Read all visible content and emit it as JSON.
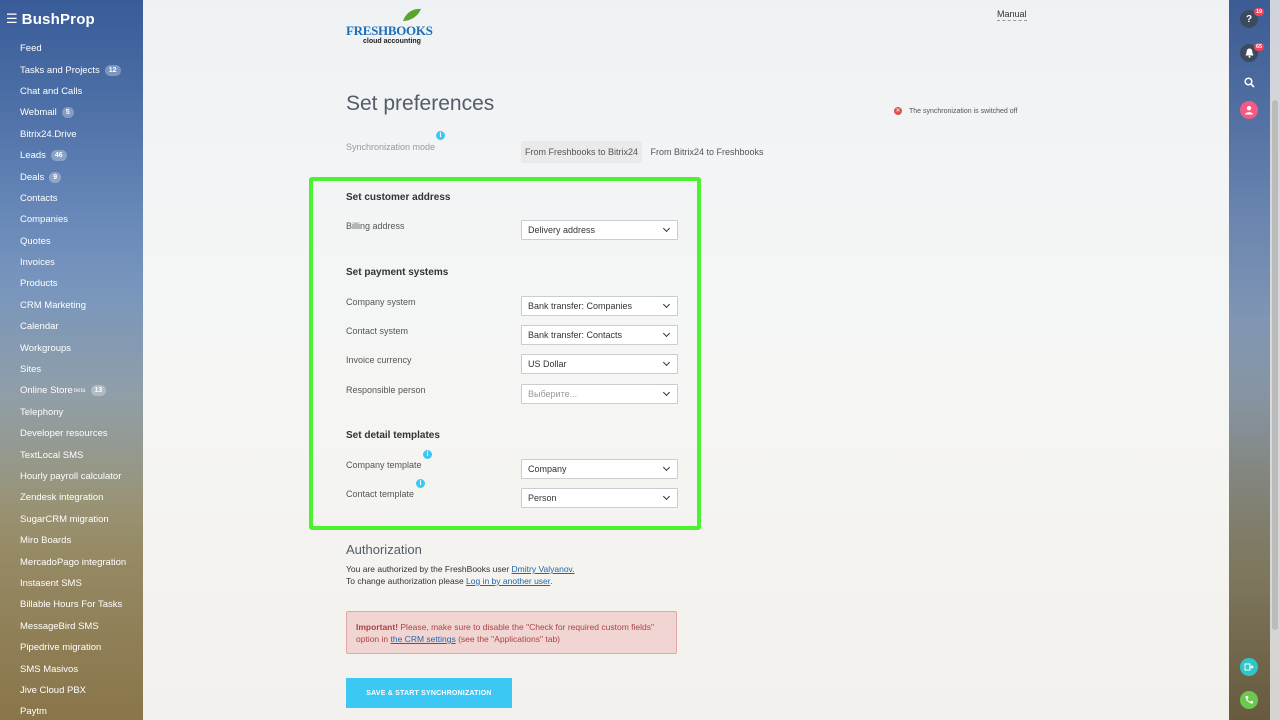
{
  "sidebar": {
    "brand": "BushProp",
    "items": [
      {
        "label": "Feed",
        "badge": ""
      },
      {
        "label": "Tasks and Projects",
        "badge": "12"
      },
      {
        "label": "Chat and Calls",
        "badge": ""
      },
      {
        "label": "Webmail",
        "badge": "5"
      },
      {
        "label": "Bitrix24.Drive",
        "badge": ""
      },
      {
        "label": "Leads",
        "badge": "46"
      },
      {
        "label": "Deals",
        "badge": "9"
      },
      {
        "label": "Contacts",
        "badge": ""
      },
      {
        "label": "Companies",
        "badge": ""
      },
      {
        "label": "Quotes",
        "badge": ""
      },
      {
        "label": "Invoices",
        "badge": ""
      },
      {
        "label": "Products",
        "badge": ""
      },
      {
        "label": "CRM Marketing",
        "badge": ""
      },
      {
        "label": "Calendar",
        "badge": ""
      },
      {
        "label": "Workgroups",
        "badge": ""
      },
      {
        "label": "Sites",
        "badge": ""
      },
      {
        "label": "Online Store",
        "sup": "beta",
        "badge": "13"
      },
      {
        "label": "Telephony",
        "badge": ""
      },
      {
        "label": "Developer resources",
        "badge": ""
      },
      {
        "label": "TextLocal SMS",
        "badge": ""
      },
      {
        "label": "Hourly payroll calculator",
        "badge": ""
      },
      {
        "label": "Zendesk integration",
        "badge": ""
      },
      {
        "label": "SugarCRM migration",
        "badge": ""
      },
      {
        "label": "Miro Boards",
        "badge": ""
      },
      {
        "label": "MercadoPago integration",
        "badge": ""
      },
      {
        "label": "Instasent SMS",
        "badge": ""
      },
      {
        "label": "Billable Hours For Tasks",
        "badge": ""
      },
      {
        "label": "MessageBird SMS",
        "badge": ""
      },
      {
        "label": "Pipedrive migration",
        "badge": ""
      },
      {
        "label": "SMS Masivos",
        "badge": ""
      },
      {
        "label": "Jive Cloud PBX",
        "badge": ""
      },
      {
        "label": "Paytm",
        "badge": ""
      }
    ]
  },
  "header": {
    "logo_main": "FRESHBOOKS",
    "logo_sub": "cloud accounting",
    "manual": "Manual"
  },
  "page": {
    "title": "Set preferences",
    "sync_status": "The synchronization is switched off",
    "sync_mode_label": "Synchronization mode",
    "mode_tabs": [
      "From Freshbooks to Bitrix24",
      "From Bitrix24 to Freshbooks"
    ]
  },
  "customer_address": {
    "title": "Set customer address",
    "billing_label": "Billing address",
    "billing_value": "Delivery address"
  },
  "payment_systems": {
    "title": "Set payment systems",
    "company_label": "Company system",
    "company_value": "Bank transfer: Companies",
    "contact_label": "Contact system",
    "contact_value": "Bank transfer: Contacts",
    "currency_label": "Invoice currency",
    "currency_value": "US Dollar",
    "responsible_label": "Responsible person",
    "responsible_placeholder": "Выберите..."
  },
  "templates": {
    "title": "Set detail templates",
    "company_label": "Company template",
    "company_value": "Company",
    "contact_label": "Contact template",
    "contact_value": "Person"
  },
  "authorization": {
    "title": "Authorization",
    "line1_prefix": "You are authorized by the FreshBooks user ",
    "user_link": "Dmitry Valyanov.",
    "line2_prefix": "To change authorization please ",
    "relogin_link": "Log in by another user",
    "line2_suffix": "."
  },
  "warning": {
    "strong": "Important!",
    "text1": " Please, make sure to disable the \"Check for required custom fields\" option in ",
    "link": "the CRM settings",
    "text2": " (see the \"Applications\" tab)"
  },
  "save_button": "SAVE & START SYNCHRONIZATION",
  "rightbar": {
    "help_badge": "19",
    "notif_badge": "65"
  },
  "colors": {
    "accent": "#3bc8f5",
    "highlight": "#4cf132",
    "warning_bg": "#f1d5d3",
    "error": "#d9534f"
  }
}
